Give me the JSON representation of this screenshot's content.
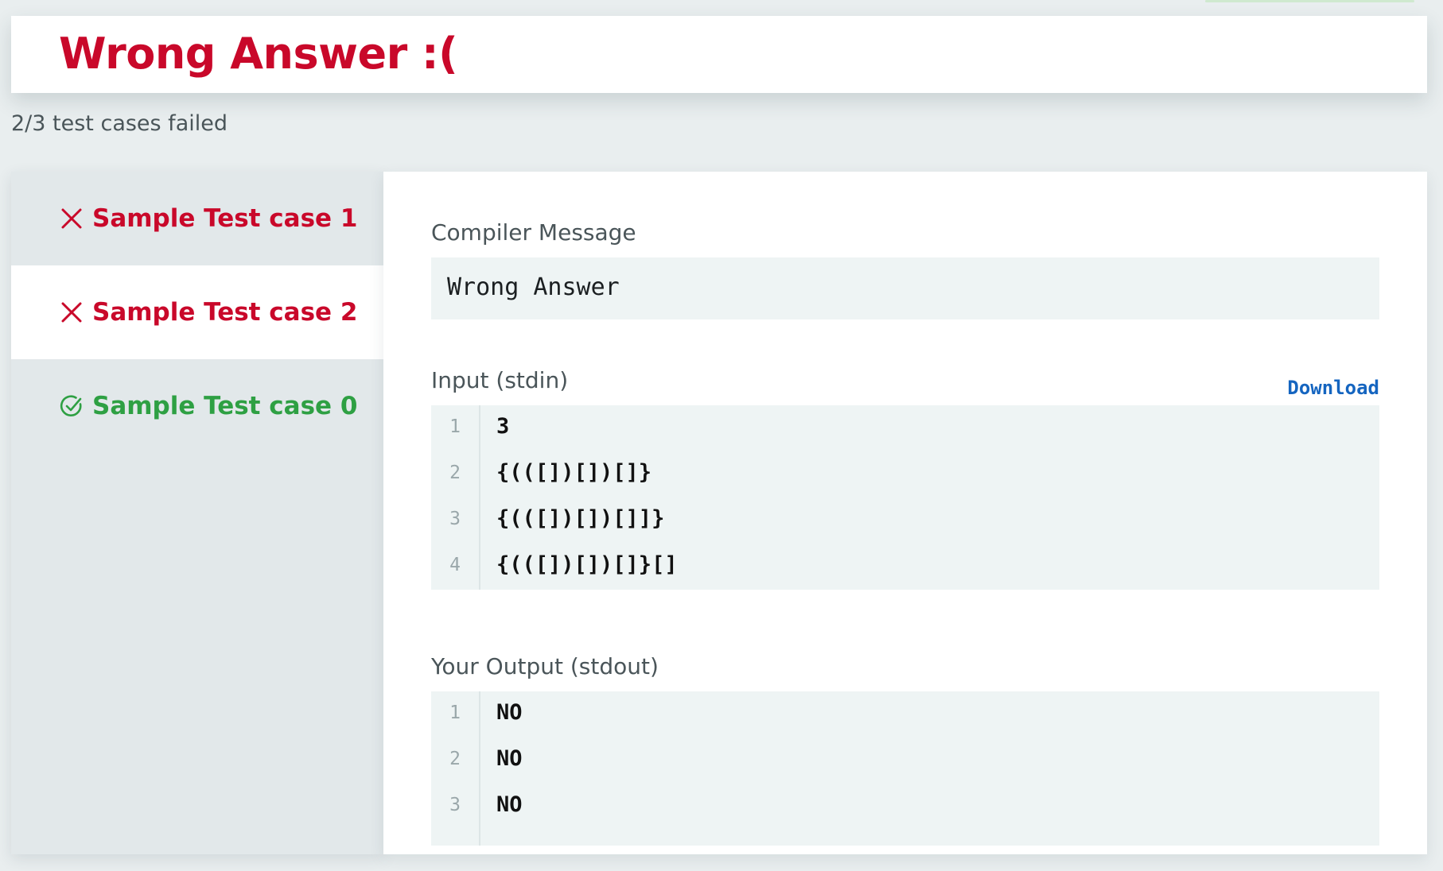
{
  "header": {
    "title": "Wrong Answer :(",
    "summary": "2/3 test cases failed"
  },
  "sidebar": {
    "tabs": [
      {
        "label": "Sample Test case 1",
        "status": "failed"
      },
      {
        "label": "Sample Test case 2",
        "status": "failed",
        "active": true
      },
      {
        "label": "Sample Test case 0",
        "status": "passed"
      }
    ]
  },
  "content": {
    "compiler_label": "Compiler Message",
    "compiler_message": "Wrong Answer",
    "input_label": "Input (stdin)",
    "download_label": "Download",
    "input_lines": [
      {
        "no": "1",
        "text": "3"
      },
      {
        "no": "2",
        "text": "{(([])[])[]}"
      },
      {
        "no": "3",
        "text": "{(([])[])[]]}"
      },
      {
        "no": "4",
        "text": "{(([])[])[]}[]"
      }
    ],
    "output_label": "Your Output (stdout)",
    "output_lines": [
      {
        "no": "1",
        "text": "NO"
      },
      {
        "no": "2",
        "text": "NO"
      },
      {
        "no": "3",
        "text": "NO"
      }
    ]
  },
  "colors": {
    "failed": "#c9082a",
    "passed": "#2ea043",
    "link": "#1565c0"
  },
  "icons": {
    "failed": "close-x-icon",
    "passed": "check-circle-icon"
  }
}
